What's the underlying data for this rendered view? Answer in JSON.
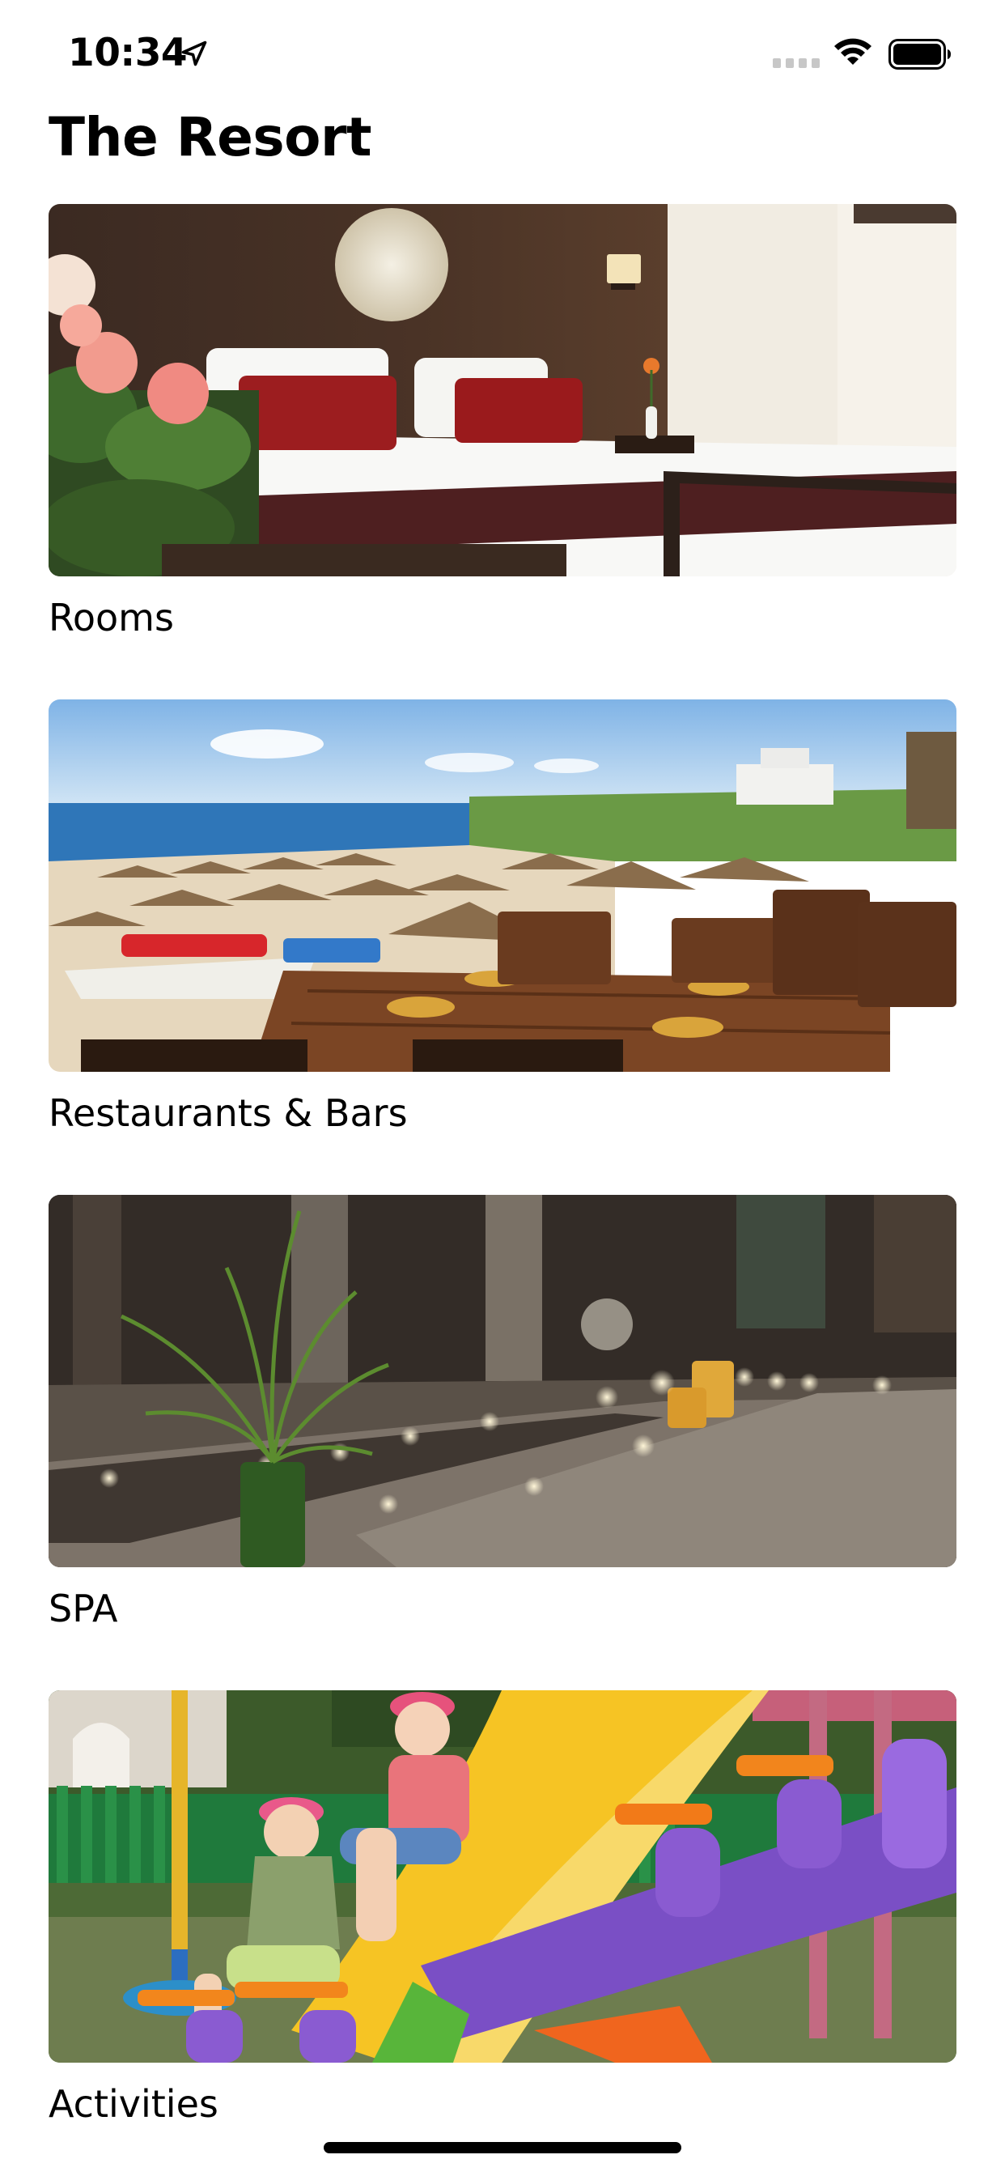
{
  "status_bar": {
    "time": "10:34",
    "icons": [
      "location-arrow-icon",
      "cellular-signal-icon",
      "wifi-icon",
      "battery-icon"
    ]
  },
  "page": {
    "title": "The Resort"
  },
  "cards": [
    {
      "label": "Rooms",
      "image": "hotel-bedroom-photo"
    },
    {
      "label": "Restaurants & Bars",
      "image": "beach-restaurant-photo"
    },
    {
      "label": "SPA",
      "image": "spa-pool-photo"
    },
    {
      "label": "Activities",
      "image": "kids-playground-photo"
    }
  ],
  "colors": {
    "background": "#ffffff",
    "text": "#000000"
  }
}
